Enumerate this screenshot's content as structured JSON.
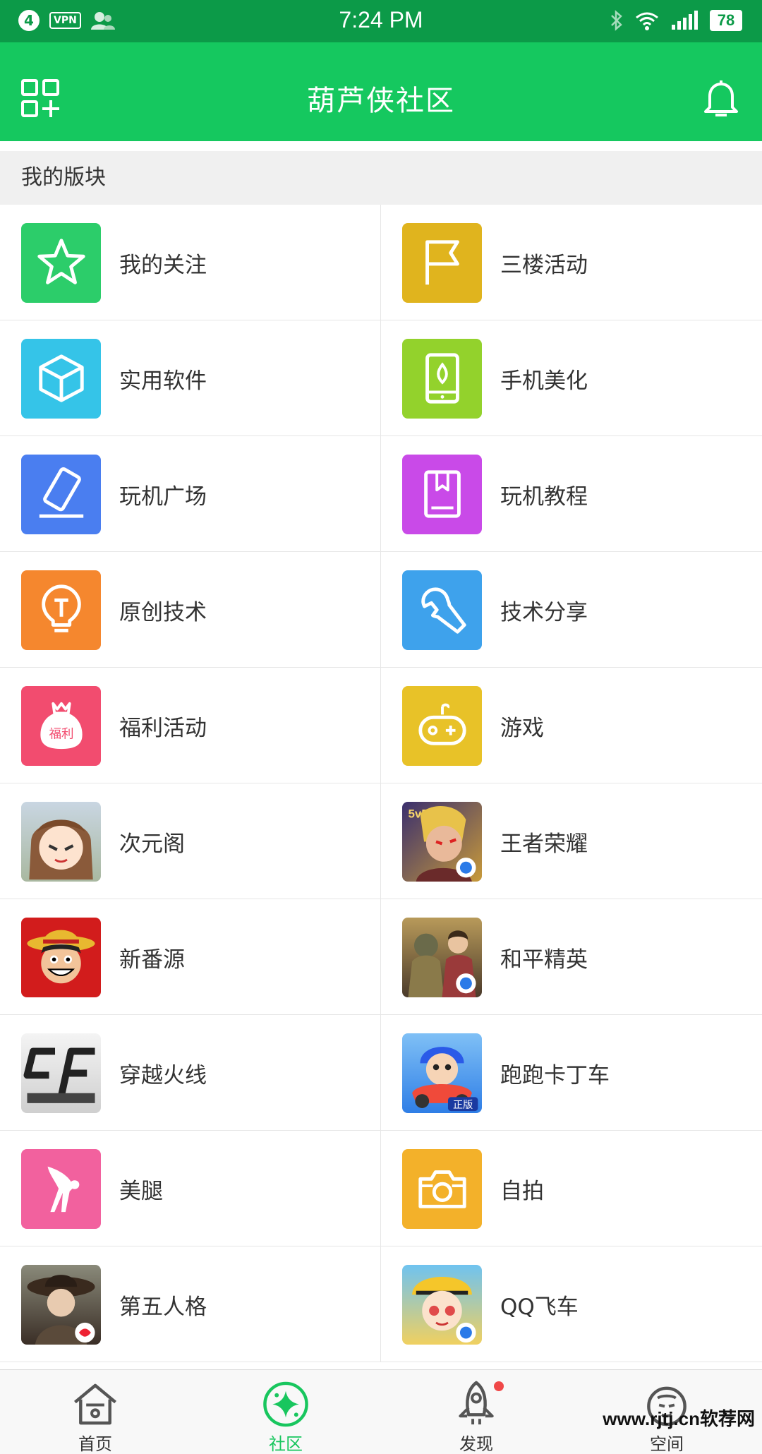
{
  "status_bar": {
    "notification_count": "4",
    "vpn_label": "VPN",
    "time": "7:24 PM",
    "battery": "78",
    "icons": [
      "person-icon",
      "bluetooth-icon",
      "wifi-icon",
      "signal-icon"
    ]
  },
  "header": {
    "title": "葫芦侠社区",
    "left_icon": "grid-add-icon",
    "right_icon": "bell-icon",
    "color": "#15c85f"
  },
  "section": {
    "title": "我的版块"
  },
  "boards": [
    {
      "label": "我的关注",
      "icon": "star-icon",
      "color": "#2ccd6a"
    },
    {
      "label": "三楼活动",
      "icon": "flag-icon",
      "color": "#e0b41e"
    },
    {
      "label": "实用软件",
      "icon": "cube-icon",
      "color": "#35c4e8"
    },
    {
      "label": "手机美化",
      "icon": "phone-leaf-icon",
      "color": "#93d22c"
    },
    {
      "label": "玩机广场",
      "icon": "phone-pen-icon",
      "color": "#4a7ef0"
    },
    {
      "label": "玩机教程",
      "icon": "book-icon",
      "color": "#c94ae8"
    },
    {
      "label": "原创技术",
      "icon": "lightbulb-icon",
      "color": "#f5872e"
    },
    {
      "label": "技术分享",
      "icon": "wrench-icon",
      "color": "#3ea2ec"
    },
    {
      "label": "福利活动",
      "icon": "money-bag-icon",
      "color": "#f24c6f",
      "badge": "福利"
    },
    {
      "label": "游戏",
      "icon": "gamepad-icon",
      "color": "#e8c228"
    },
    {
      "label": "次元阁",
      "icon": "anime-girl-avatar",
      "color": "#b9c3cf"
    },
    {
      "label": "王者荣耀",
      "icon": "honor-of-kings-avatar",
      "color": "#5a4a8a",
      "badge": "5v5"
    },
    {
      "label": "新番源",
      "icon": "one-piece-luffy-avatar",
      "color": "#d61d1d"
    },
    {
      "label": "和平精英",
      "icon": "peace-elite-avatar",
      "color": "#6f6a4a"
    },
    {
      "label": "穿越火线",
      "icon": "crossfire-logo",
      "color": "#e8e8e8"
    },
    {
      "label": "跑跑卡丁车",
      "icon": "kart-rider-avatar",
      "color": "#3b88f0",
      "badge": "正版"
    },
    {
      "label": "美腿",
      "icon": "silhouette-icon",
      "color": "#f2619e"
    },
    {
      "label": "自拍",
      "icon": "camera-icon",
      "color": "#f3b12a"
    },
    {
      "label": "第五人格",
      "icon": "identity-v-avatar",
      "color": "#6d5a4a"
    },
    {
      "label": "QQ飞车",
      "icon": "qq-speed-avatar",
      "color": "#f0c420"
    }
  ],
  "bottom_nav": {
    "items": [
      {
        "label": "首页",
        "icon": "home-icon",
        "active": false
      },
      {
        "label": "社区",
        "icon": "community-sparkle-icon",
        "active": true
      },
      {
        "label": "发现",
        "icon": "rocket-icon",
        "active": false,
        "dot": true
      },
      {
        "label": "空间",
        "icon": "face-icon",
        "active": false
      }
    ],
    "active_color": "#18c65e"
  },
  "watermark": "www.rjtj.cn软荐网"
}
